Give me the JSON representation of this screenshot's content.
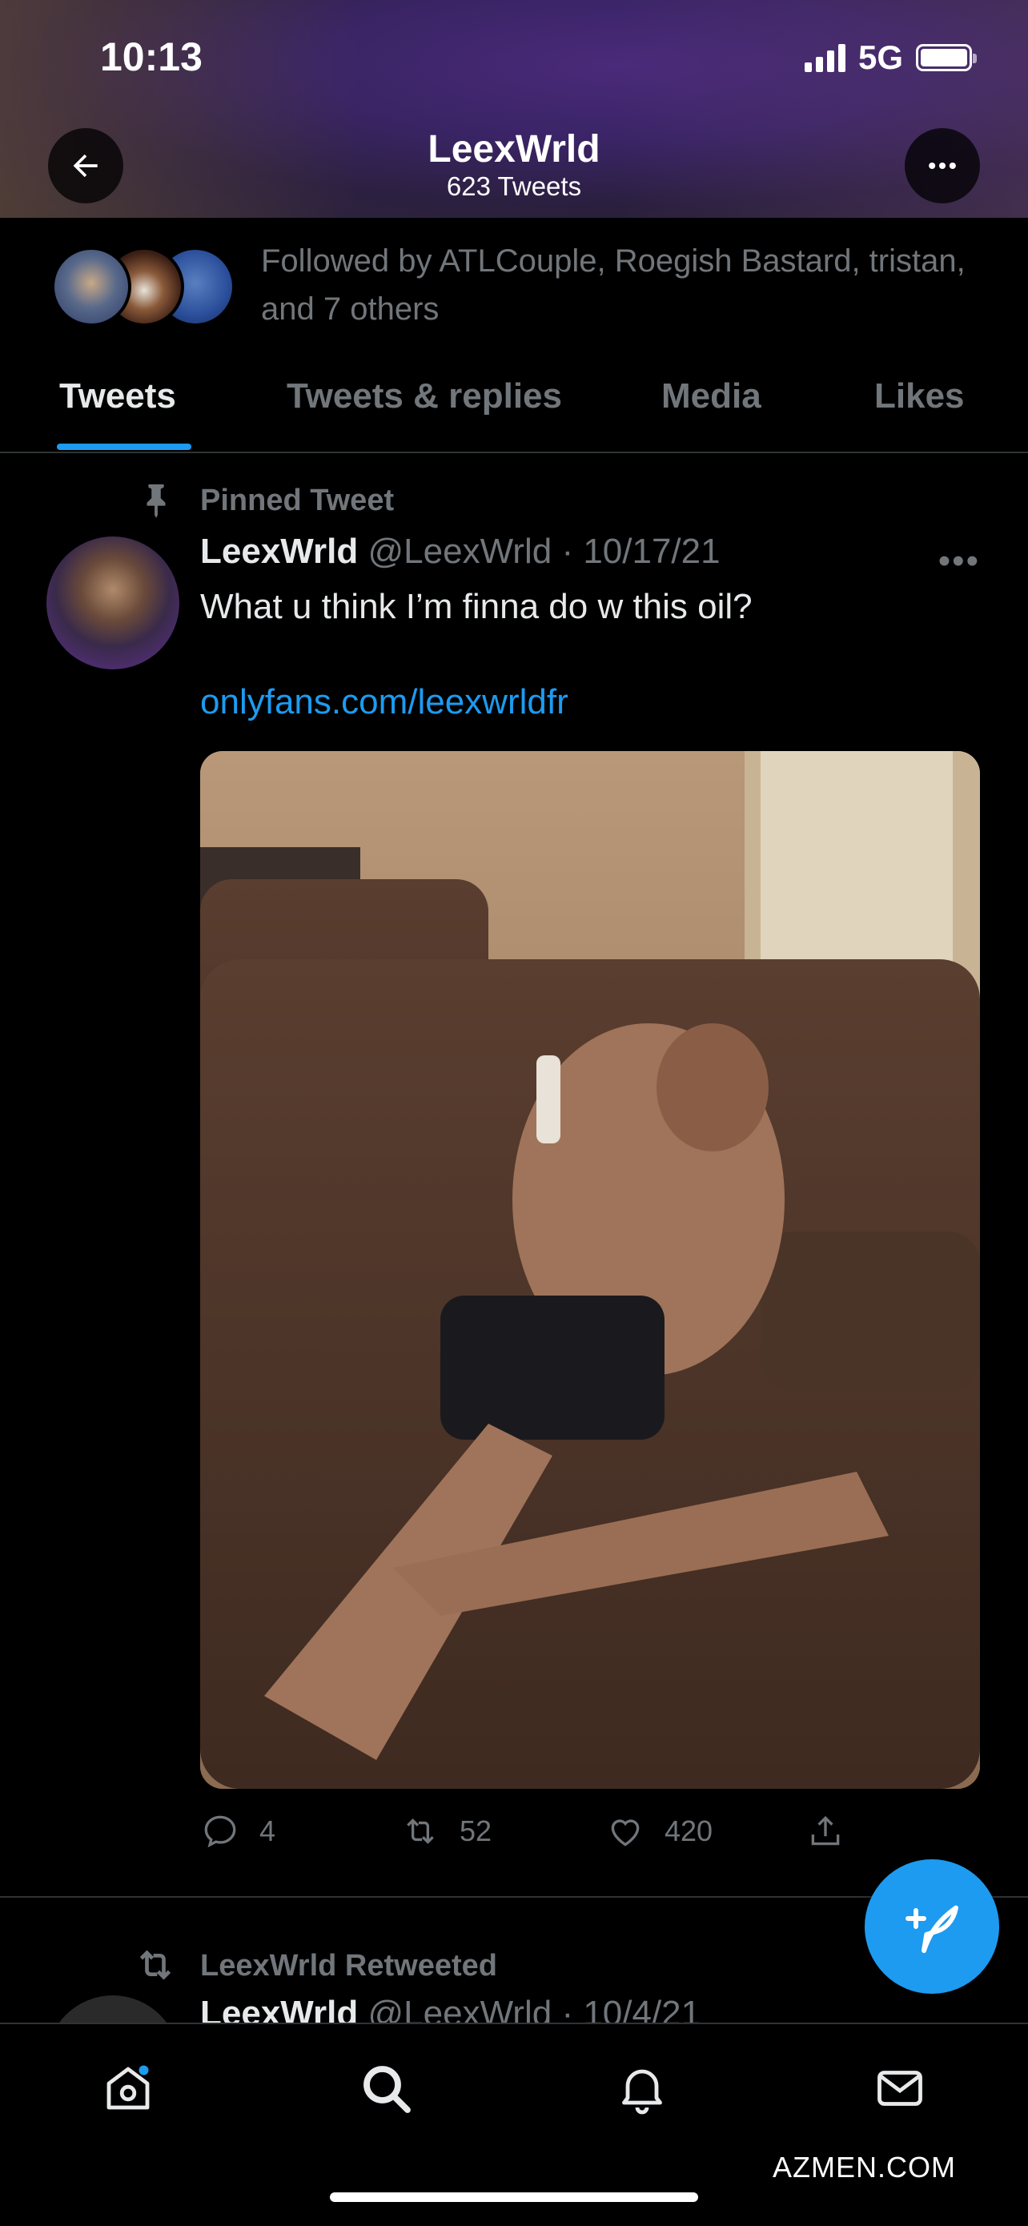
{
  "status_bar": {
    "time": "10:13",
    "network": "5G"
  },
  "header": {
    "name": "LeexWrld",
    "tweet_count": "623 Tweets"
  },
  "followed_by": {
    "text": "Followed by ATLCouple, Roegish Bastard, tristan, and 7 others"
  },
  "tabs": [
    {
      "label": "Tweets",
      "active": true
    },
    {
      "label": "Tweets & replies",
      "active": false
    },
    {
      "label": "Media",
      "active": false
    },
    {
      "label": "Likes",
      "active": false
    }
  ],
  "pinned_tweet": {
    "label": "Pinned Tweet",
    "name": "LeexWrld",
    "handle": "@LeexWrld",
    "date": "· 10/17/21",
    "text": "What u think I’m finna do w this oil?",
    "link": "onlyfans.com/leexwrldfr",
    "replies": "4",
    "retweets": "52",
    "likes": "420"
  },
  "next_tweet": {
    "retweet_label": "LeexWrld Retweeted",
    "name": "LeexWrld",
    "handle": "@LeexWrld",
    "date": "· 10/4/21"
  },
  "watermark": "AZMEN.COM",
  "colors": {
    "accent": "#1d9bf0",
    "muted": "#71767b",
    "background": "#000000"
  },
  "icons": [
    "back-arrow-icon",
    "more-icon",
    "pin-icon",
    "reply-icon",
    "retweet-icon",
    "like-icon",
    "share-icon",
    "compose-icon",
    "home-icon",
    "search-icon",
    "bell-icon",
    "mail-icon"
  ]
}
